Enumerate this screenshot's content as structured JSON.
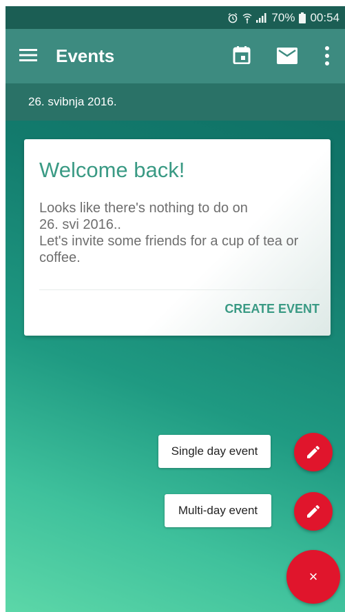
{
  "status_bar": {
    "battery": "70%",
    "time": "00:54",
    "icons": [
      "alarm-icon",
      "wifi-icon",
      "signal-icon",
      "battery-icon"
    ]
  },
  "app_bar": {
    "title": "Events",
    "icons": [
      "menu-icon",
      "calendar-icon",
      "mail-icon",
      "more-vert-icon"
    ]
  },
  "date_header": "26. svibnja 2016.",
  "welcome_card": {
    "title": "Welcome back!",
    "message": "Looks like there's nothing to do on\n26. svi 2016..\nLet's invite some friends for a cup of tea or coffee.",
    "action": "CREATE EVENT"
  },
  "fab_menu": {
    "items": [
      {
        "label": "Single day event",
        "icon": "pencil-icon"
      },
      {
        "label": "Multi-day event",
        "icon": "pencil-icon"
      }
    ],
    "close_label": "×"
  },
  "colors": {
    "status_bar": "#1b5e54",
    "app_bar": "#3d8b80",
    "date_bar": "#2a7267",
    "accent": "#3a9a84",
    "fab": "#e0152c"
  }
}
